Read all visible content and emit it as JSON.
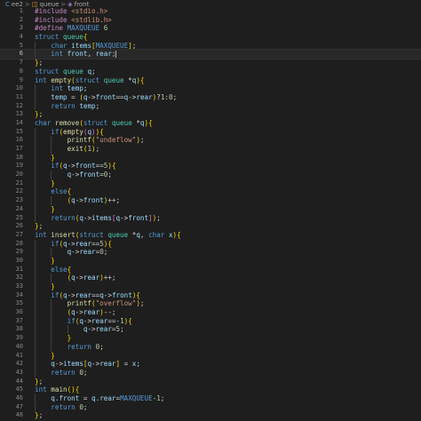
{
  "breadcrumb": {
    "file": "ee2",
    "symbol": "queue",
    "member": "front",
    "separator": ">"
  },
  "editor": {
    "active_line": 6,
    "lines": [
      {
        "n": "1",
        "t": "#include <stdio.h>"
      },
      {
        "n": "2",
        "t": "#include <stdlib.h>"
      },
      {
        "n": "3",
        "t": "#define MAXQUEUE 6"
      },
      {
        "n": "4",
        "t": "struct queue{"
      },
      {
        "n": "5",
        "t": "    char items[MAXQUEUE];"
      },
      {
        "n": "6",
        "t": "    int front, rear;"
      },
      {
        "n": "7",
        "t": "};"
      },
      {
        "n": "8",
        "t": "struct queue q;"
      },
      {
        "n": "9",
        "t": "int empty(struct queue *q){"
      },
      {
        "n": "10",
        "t": "    int temp;"
      },
      {
        "n": "11",
        "t": "    temp = (q->front==q->rear)?1:0;"
      },
      {
        "n": "12",
        "t": "    return temp;"
      },
      {
        "n": "13",
        "t": "};"
      },
      {
        "n": "14",
        "t": "char remove(struct queue *q){"
      },
      {
        "n": "15",
        "t": "    if(empty(q)){"
      },
      {
        "n": "16",
        "t": "        printf(\"undeflow\");"
      },
      {
        "n": "17",
        "t": "        exit(1);"
      },
      {
        "n": "18",
        "t": "    }"
      },
      {
        "n": "19",
        "t": "    if(q->front==5){"
      },
      {
        "n": "20",
        "t": "        q->front=0;"
      },
      {
        "n": "21",
        "t": "    }"
      },
      {
        "n": "22",
        "t": "    else{"
      },
      {
        "n": "23",
        "t": "        (q->front)++;"
      },
      {
        "n": "24",
        "t": "    }"
      },
      {
        "n": "25",
        "t": "    return(q->items[q->front]);"
      },
      {
        "n": "26",
        "t": "};"
      },
      {
        "n": "27",
        "t": "int insert(struct queue *q, char x){"
      },
      {
        "n": "28",
        "t": "    if(q->rear==5){"
      },
      {
        "n": "29",
        "t": "        q->rear=0;"
      },
      {
        "n": "30",
        "t": "    }"
      },
      {
        "n": "31",
        "t": "    else{"
      },
      {
        "n": "32",
        "t": "        (q->rear)++;"
      },
      {
        "n": "33",
        "t": "    }"
      },
      {
        "n": "34",
        "t": "    if(q->rear==q->front){"
      },
      {
        "n": "35",
        "t": "        printf(\"overflow\");"
      },
      {
        "n": "36",
        "t": "        (q->rear)--;"
      },
      {
        "n": "37",
        "t": "        if(q->rear==-1){"
      },
      {
        "n": "38",
        "t": "            q->rear=5;"
      },
      {
        "n": "39",
        "t": "        }"
      },
      {
        "n": "40",
        "t": "        return 0;"
      },
      {
        "n": "41",
        "t": "    }"
      },
      {
        "n": "42",
        "t": "    q->items[q->rear] = x;"
      },
      {
        "n": "43",
        "t": "    return 0;"
      },
      {
        "n": "44",
        "t": "};"
      },
      {
        "n": "45",
        "t": "int main(){"
      },
      {
        "n": "46",
        "t": "    q.front = q.rear=MAXQUEUE-1;"
      },
      {
        "n": "47",
        "t": "    return 0;"
      },
      {
        "n": "48",
        "t": "};"
      }
    ]
  },
  "colors": {
    "background": "#1e1e1e",
    "keyword": "#569cd6",
    "preprocessor": "#c586c0",
    "string": "#ce9178",
    "number": "#b5cea8",
    "function": "#dcdcaa",
    "variable": "#9cdcfe",
    "line_number": "#858585"
  }
}
